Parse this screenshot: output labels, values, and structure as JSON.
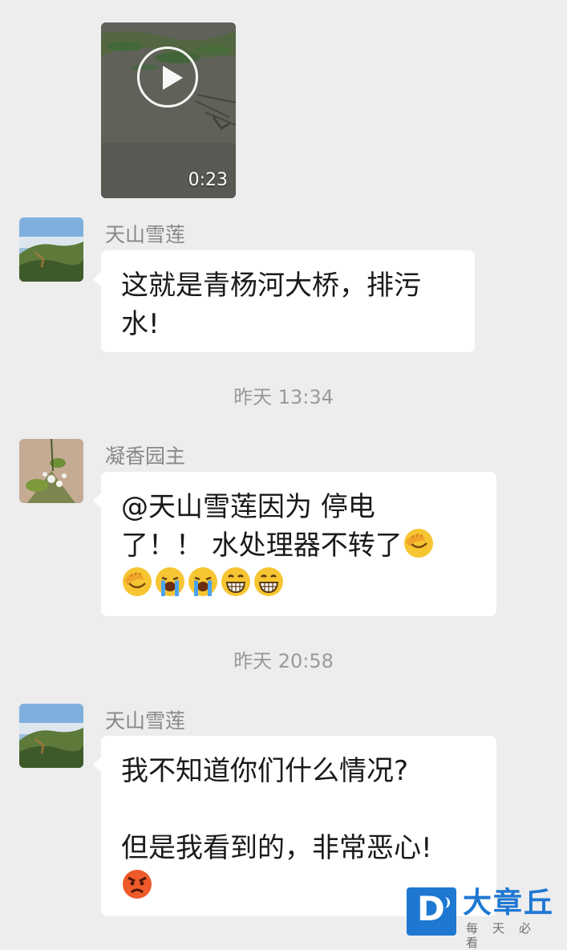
{
  "conversation": {
    "video": {
      "duration": "0:23",
      "icon": "play-icon"
    },
    "messages": [
      {
        "sender": "天山雪莲",
        "lines": [
          "这就是青杨河大桥，排污",
          "水!"
        ]
      },
      {
        "timestamp": "昨天 13:34",
        "sender": "凝香园主",
        "lines": [
          "@天山雪莲因为  停电",
          "了！！ 水处理器不转了"
        ],
        "emoji": [
          "facepalm-emoji",
          "facepalm-emoji",
          "crying-emoji",
          "crying-emoji",
          "grinning-emoji",
          "grinning-emoji"
        ]
      },
      {
        "timestamp": "昨天 20:58",
        "sender": "天山雪莲",
        "lines": [
          "我不知道你们什么情况?",
          "但是我看到的，非常恶心!"
        ],
        "emoji": [
          "angry-emoji"
        ]
      }
    ]
  },
  "watermark": {
    "logo_letter": "D",
    "name": "大章丘",
    "tagline": "每天必看",
    "color": "#1e78d2"
  },
  "colors": {
    "background": "#ededed",
    "bubble": "#ffffff",
    "text": "#1a1a1a",
    "meta_text": "#888888"
  }
}
